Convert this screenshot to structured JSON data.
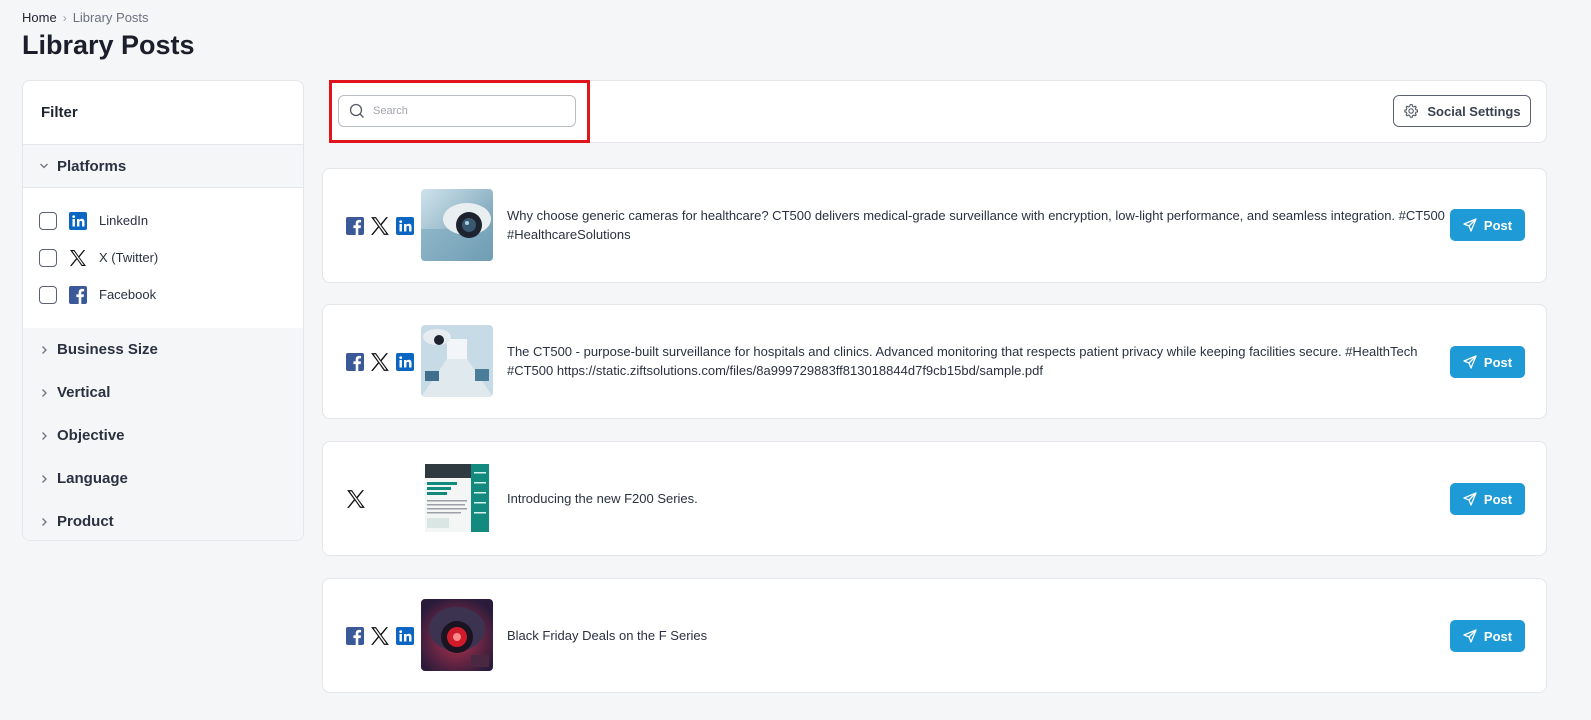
{
  "breadcrumb": {
    "home": "Home",
    "current": "Library Posts"
  },
  "page_title": "Library Posts",
  "sidebar": {
    "filter_title": "Filter",
    "platforms_label": "Platforms",
    "platforms": [
      {
        "label": "LinkedIn",
        "icon": "linkedin-icon"
      },
      {
        "label": "X (Twitter)",
        "icon": "x-icon"
      },
      {
        "label": "Facebook",
        "icon": "facebook-icon"
      }
    ],
    "sections": [
      "Business Size",
      "Vertical",
      "Objective",
      "Language",
      "Product"
    ]
  },
  "search": {
    "placeholder": "Search",
    "value": ""
  },
  "social_settings_label": "Social Settings",
  "posts": [
    {
      "text": "Why choose generic cameras for healthcare? CT500 delivers medical-grade surveillance with encryption, low-light performance, and seamless integration. #CT500 #HealthcareSolutions",
      "platforms": [
        "facebook",
        "x",
        "linkedin"
      ],
      "button": "Post"
    },
    {
      "text": "The CT500 - purpose-built surveillance for hospitals and clinics. Advanced monitoring that respects patient privacy while keeping facilities secure. #HealthTech #CT500  https://static.ziftsolutions.com/files/8a999729883ff813018844d7f9cb15bd/sample.pdf",
      "platforms": [
        "facebook",
        "x",
        "linkedin"
      ],
      "button": "Post"
    },
    {
      "text": "Introducing the new F200 Series.",
      "platforms": [
        "x"
      ],
      "button": "Post"
    },
    {
      "text": "Black Friday Deals on the F Series",
      "platforms": [
        "facebook",
        "x",
        "linkedin"
      ],
      "button": "Post"
    }
  ],
  "colors": {
    "accent": "#1e9ad6",
    "highlight": "#e0141c",
    "facebook": "#3b5998",
    "linkedin": "#0a66c2"
  }
}
